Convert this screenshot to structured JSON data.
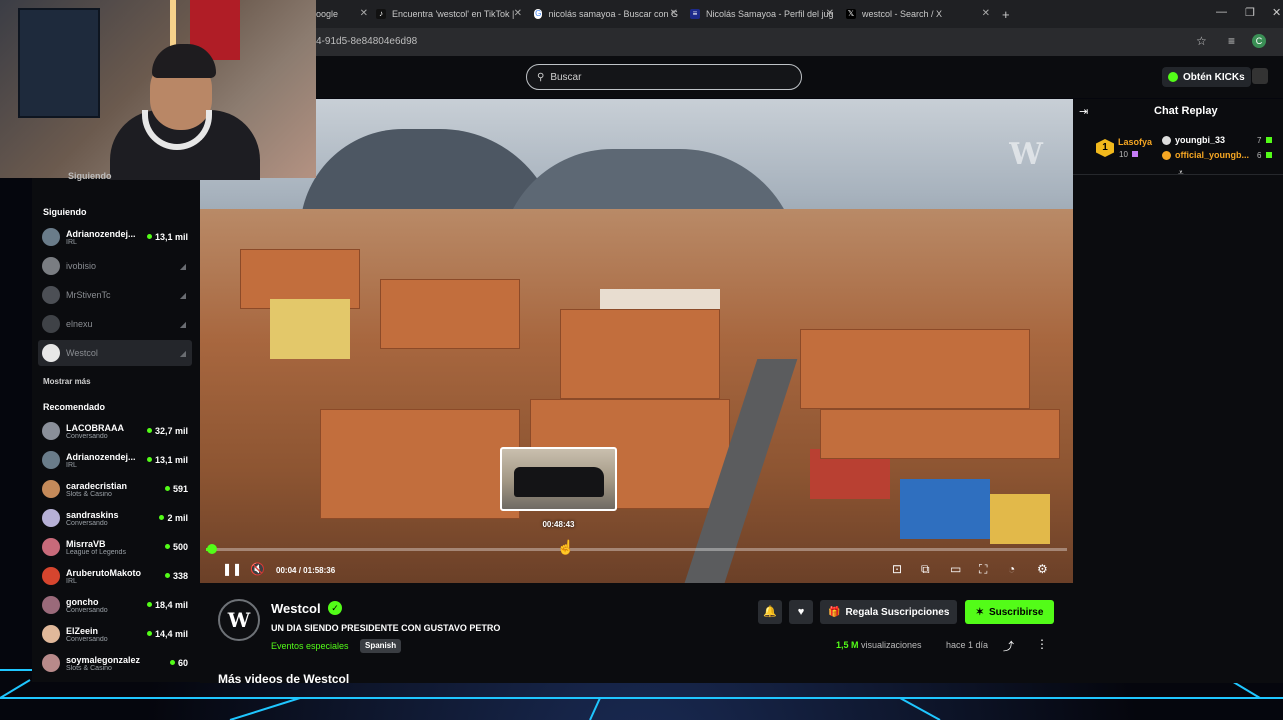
{
  "browser": {
    "tabs": [
      {
        "title": "oogle",
        "icon": "google-icon"
      },
      {
        "title": "Encuentra 'westcol' en TikTok |",
        "icon": "tiktok-icon"
      },
      {
        "title": "nicolás samayoa - Buscar con G",
        "icon": "google-icon"
      },
      {
        "title": "Nicolás Samayoa - Perfil del jug",
        "icon": "site-icon"
      },
      {
        "title": "westcol - Search / X",
        "icon": "x-icon"
      }
    ],
    "new_tab": "+",
    "url": "4-91d5-8e84804e6d98",
    "profile_initial": "C"
  },
  "header": {
    "search_placeholder": "Buscar",
    "kicks_button": "Obtén KICKs"
  },
  "sidebar": {
    "top_label": "Siguiendo",
    "following_title": "Siguiendo",
    "following": [
      {
        "name": "Adrianozendej...",
        "category": "IRL",
        "viewers": "13,1 mil",
        "live": true,
        "color": "#6a7c8a"
      },
      {
        "name": "ivobisio",
        "live": false,
        "color": "#7a7d82"
      },
      {
        "name": "MrStivenTc",
        "live": false,
        "color": "#4c4f55"
      },
      {
        "name": "elnexu",
        "live": false,
        "color": "#3f4247"
      },
      {
        "name": "Westcol",
        "live": false,
        "color": "#e7e7e7"
      }
    ],
    "show_more": "Mostrar más",
    "recommended_title": "Recomendado",
    "recommended": [
      {
        "name": "LACOBRAAA",
        "category": "Conversando",
        "viewers": "32,7 mil",
        "color": "#8a8f99"
      },
      {
        "name": "Adrianozendej...",
        "category": "IRL",
        "viewers": "13,1 mil",
        "color": "#6a7c8a"
      },
      {
        "name": "caradecristian",
        "category": "Slots & Casino",
        "viewers": "591",
        "color": "#c48a5a"
      },
      {
        "name": "sandraskins",
        "category": "Conversando",
        "viewers": "2 mil",
        "color": "#b6b0d6"
      },
      {
        "name": "MisrraVB",
        "category": "League of Legends",
        "viewers": "500",
        "color": "#c86a7a"
      },
      {
        "name": "AruberutoMakoto",
        "category": "IRL",
        "viewers": "338",
        "color": "#d6452e"
      },
      {
        "name": "goncho",
        "category": "Conversando",
        "viewers": "18,4 mil",
        "color": "#9a6a7a"
      },
      {
        "name": "ElZeein",
        "category": "Conversando",
        "viewers": "14,4 mil",
        "color": "#e0b89a"
      },
      {
        "name": "soymalegonzalez",
        "category": "Slots & Casino",
        "viewers": "60",
        "color": "#b88a8a"
      }
    ]
  },
  "player": {
    "preview_time": "00:48:43",
    "current_time": "00:04",
    "separator": "/",
    "duration": "01:58:36",
    "progress": 0.001,
    "watermark": "W"
  },
  "video": {
    "channel_initial": "W",
    "channel": "Westcol",
    "title": "UN DIA SIENDO PRESIDENTE CON GUSTAVO PETRO",
    "category": "Eventos especiales",
    "language": "Spanish",
    "gift_button": "Regala Suscripciones",
    "subscribe_button": "Suscribirse",
    "views_count": "1,5 M",
    "views_label": "visualizaciones",
    "ago": "hace 1 día",
    "more_videos": "Más videos de Westcol"
  },
  "chat": {
    "title": "Chat Replay",
    "leader": {
      "rank": "1",
      "name": "Lasofya",
      "value": "10"
    },
    "entries": [
      {
        "name": "youngbi_33",
        "value": "7",
        "color": "#ffffff"
      },
      {
        "name": "official_youngb...",
        "value": "6",
        "color": "#f5a623"
      }
    ]
  },
  "colors": {
    "accent": "#53fc18",
    "background": "#0b0c0f"
  }
}
